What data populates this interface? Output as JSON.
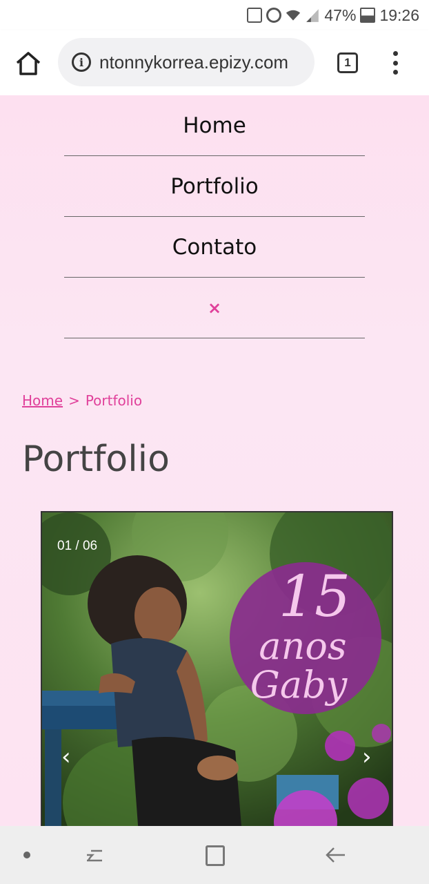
{
  "status_bar": {
    "battery": "47%",
    "time": "19:26"
  },
  "browser": {
    "url": "ntonnykorrea.epizy.com",
    "tab_count": "1"
  },
  "nav_menu": {
    "items": [
      {
        "label": "Home"
      },
      {
        "label": "Portfolio"
      },
      {
        "label": "Contato"
      }
    ],
    "close_label": "×"
  },
  "breadcrumb": {
    "home": "Home",
    "separator": ">",
    "current": "Portfolio"
  },
  "page_title": "Portfolio",
  "slider": {
    "counter": "01 / 06",
    "prev_label": "‹",
    "next_label": "›",
    "image_text_line1": "15",
    "image_text_line2": "anos",
    "image_text_line3": "Gaby"
  },
  "colors": {
    "accent": "#e0409a",
    "page_bg": "#fde3f2",
    "title": "#444444"
  }
}
